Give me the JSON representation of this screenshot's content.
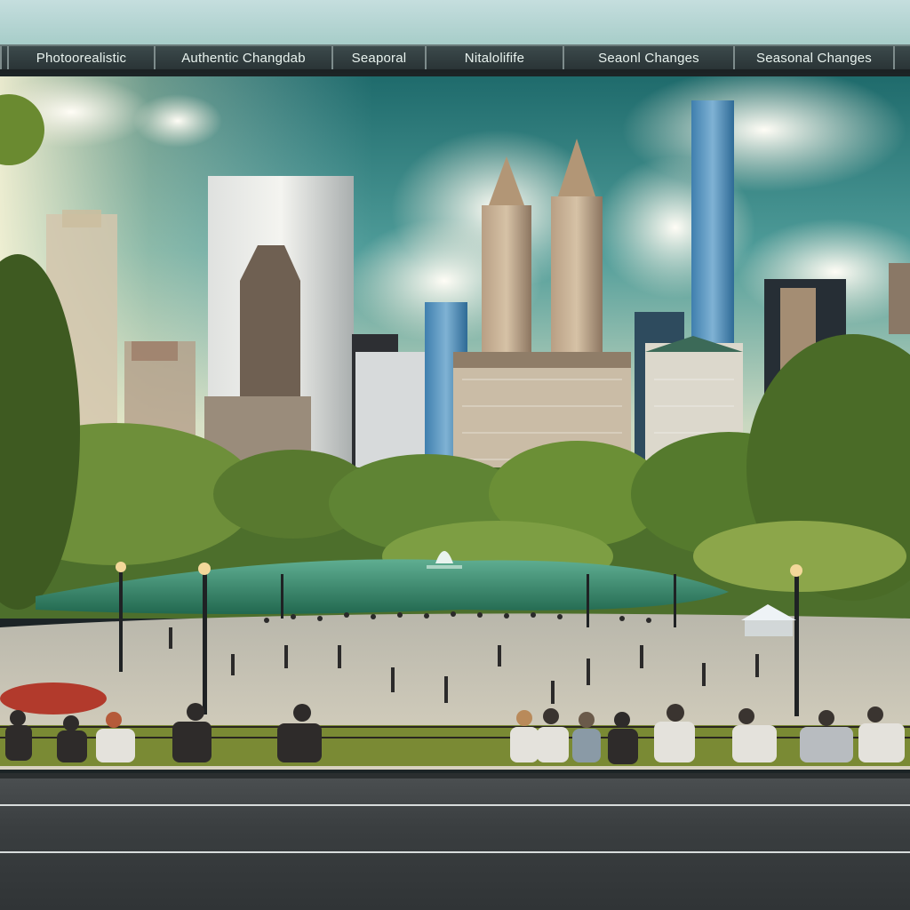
{
  "tabs": [
    {
      "label": "Photoorealistic"
    },
    {
      "label": "Authentic Changdab"
    },
    {
      "label": "Seaporal"
    },
    {
      "label": "Nitalolifife"
    },
    {
      "label": "Seaonl Changes"
    },
    {
      "label": "Seasonal Changes"
    }
  ],
  "colors": {
    "sky_top": "#1f6e6e",
    "sky_mid": "#5aa7a4",
    "foliage": "#4f7a2c",
    "lake": "#2f7d63",
    "plaza": "#c9c4b6",
    "tent": "#e8eef2"
  }
}
